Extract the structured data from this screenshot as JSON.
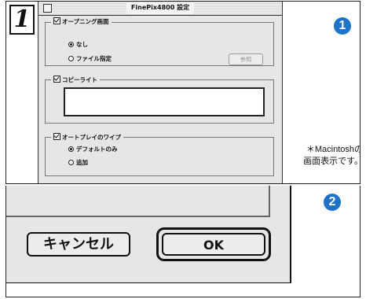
{
  "colors": {
    "accent_blue": "#1e73c8",
    "dialog_gray": "#e6e6e6"
  },
  "step_number": "1",
  "callouts": {
    "one": "1",
    "two": "2"
  },
  "note": {
    "line1": "＊Macintoshの",
    "line2": "画面表示です。"
  },
  "dialog": {
    "title": "FinePix4800 設定",
    "opening": {
      "label": "オープニング画面",
      "options": [
        "なし",
        "ファイル指定"
      ],
      "selected": "なし",
      "browse_button": "参照"
    },
    "copyright": {
      "label": "コピーライト",
      "value": ""
    },
    "autoplay_wipe": {
      "label": "オートプレイのワイプ",
      "options": [
        "デフォルトのみ",
        "追加"
      ],
      "selected": "デフォルトのみ"
    }
  },
  "closeup": {
    "cancel_label": "キャンセル",
    "ok_label": "OK"
  }
}
